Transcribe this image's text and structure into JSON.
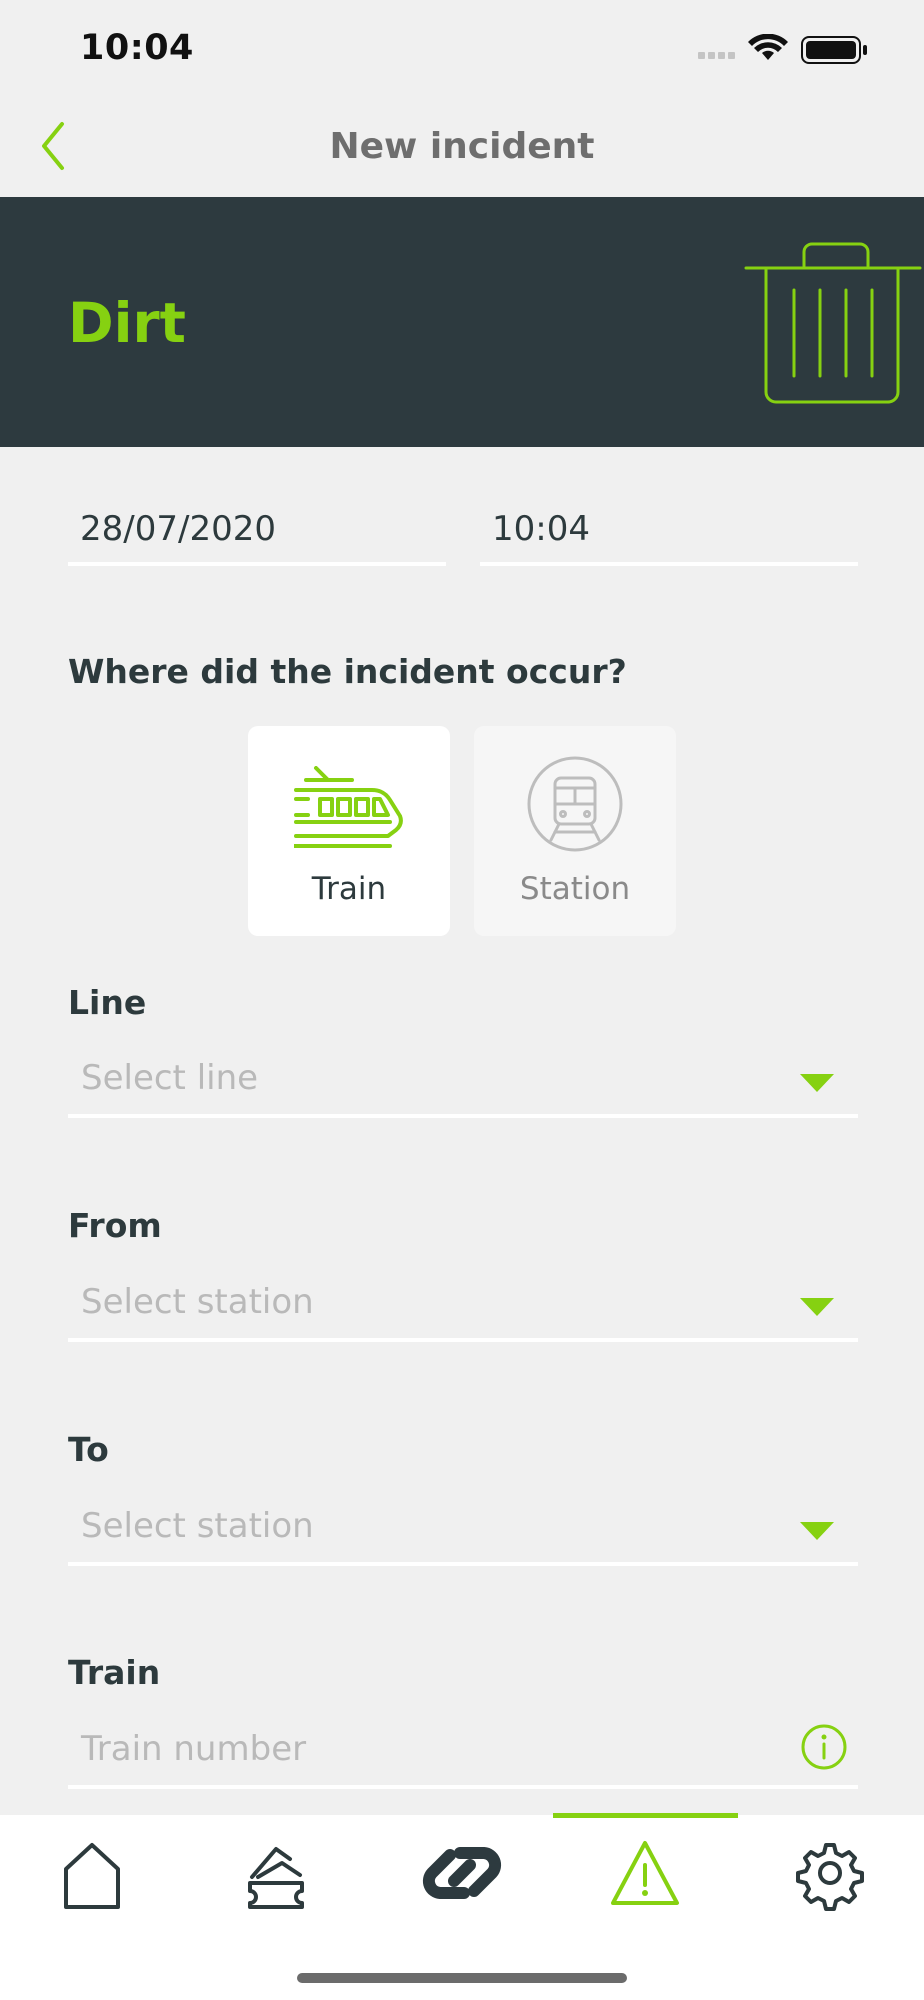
{
  "status_bar": {
    "time": "10:04"
  },
  "nav": {
    "title": "New incident"
  },
  "banner": {
    "title": "Dirt",
    "icon": "trash-icon"
  },
  "datetime": {
    "date": "28/07/2020",
    "time": "10:04"
  },
  "location": {
    "question": "Where did the incident occur?",
    "options": [
      {
        "label": "Train",
        "icon": "tram-icon",
        "selected": true
      },
      {
        "label": "Station",
        "icon": "station-icon",
        "selected": false
      }
    ]
  },
  "fields": {
    "line": {
      "label": "Line",
      "placeholder": "Select line"
    },
    "from": {
      "label": "From",
      "placeholder": "Select station"
    },
    "to": {
      "label": "To",
      "placeholder": "Select station"
    },
    "train": {
      "label": "Train",
      "placeholder": "Train number"
    }
  },
  "tabbar": {
    "items": [
      {
        "name": "home",
        "icon": "home-icon"
      },
      {
        "name": "tickets",
        "icon": "ticket-icon"
      },
      {
        "name": "connect",
        "icon": "link-icon"
      },
      {
        "name": "incidents",
        "icon": "warning-icon",
        "active": true
      },
      {
        "name": "settings",
        "icon": "gear-icon"
      }
    ]
  },
  "colors": {
    "accent": "#86d111",
    "dark": "#2d3a3f",
    "background": "#f0f0f0"
  }
}
